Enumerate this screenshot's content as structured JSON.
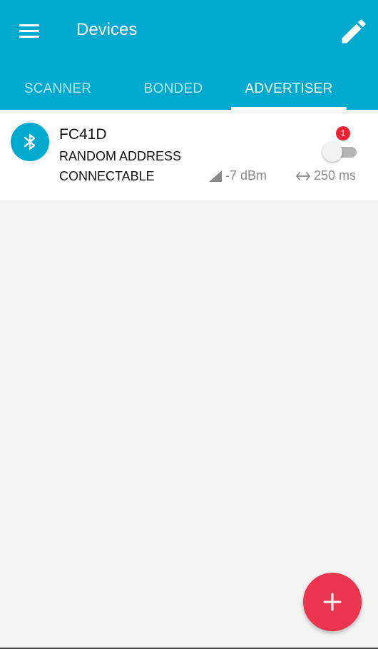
{
  "appbar": {
    "title": "Devices",
    "menu_icon": "hamburger-menu-icon",
    "edit_icon": "pencil-edit-icon",
    "color": "#00a9ce"
  },
  "tabs": [
    {
      "label": "SCANNER",
      "active": false
    },
    {
      "label": "BONDED",
      "active": false
    },
    {
      "label": "ADVERTISER",
      "active": true
    }
  ],
  "advertiser": {
    "icon": "bluetooth-icon",
    "name": "FC41D",
    "address_type": "RANDOM ADDRESS",
    "connectable": "CONNECTABLE",
    "badge_count": "1",
    "enabled": false,
    "tx_power": "-7 dBm",
    "interval": "250 ms"
  },
  "fab": {
    "icon": "plus-icon",
    "color": "#ea3551"
  }
}
